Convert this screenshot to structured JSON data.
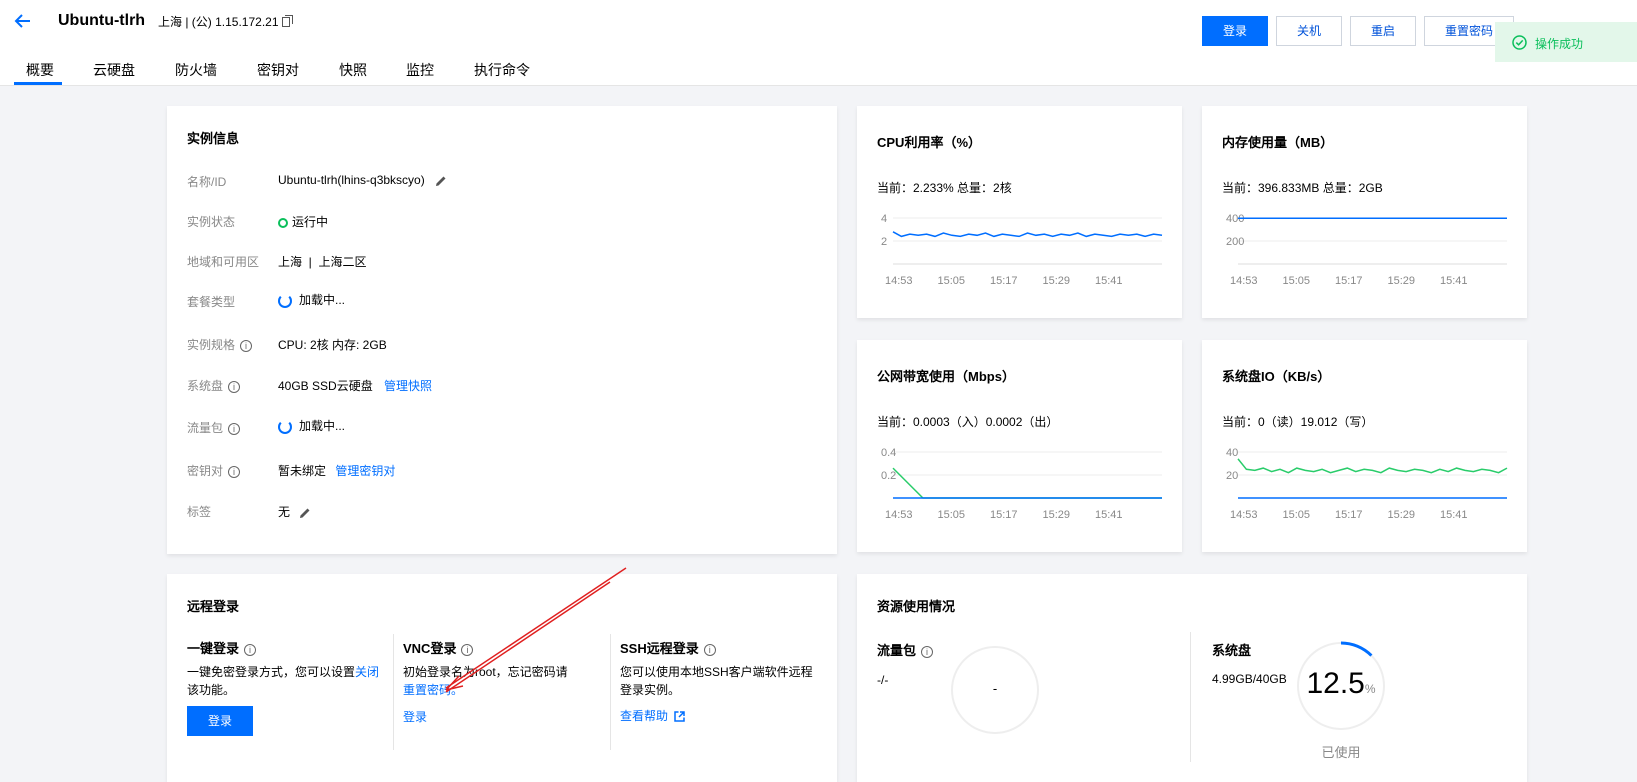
{
  "header": {
    "title": "Ubuntu-tlrh",
    "subtitle": "上海 | (公) 1.15.172.21",
    "buttons": {
      "login": "登录",
      "shutdown": "关机",
      "restart": "重启",
      "reset_password": "重置密码"
    }
  },
  "tabs": [
    "概要",
    "云硬盘",
    "防火墙",
    "密钥对",
    "快照",
    "监控",
    "执行命令"
  ],
  "toast": {
    "text": "操作成功"
  },
  "instance_info": {
    "title": "实例信息",
    "rows": {
      "name_label": "名称/ID",
      "name_value": "Ubuntu-tlrh(lhins-q3bkscyo)",
      "status_label": "实例状态",
      "status_value": "运行中",
      "region_label": "地域和可用区",
      "region_value": "上海  |  上海二区",
      "plan_label": "套餐类型",
      "plan_value": "加载中...",
      "spec_label": "实例规格",
      "spec_value": "CPU: 2核 内存: 2GB",
      "disk_label": "系统盘",
      "disk_value": "40GB SSD云硬盘",
      "disk_link": "管理快照",
      "traffic_label": "流量包",
      "traffic_value": "加载中...",
      "keypair_label": "密钥对",
      "keypair_value": "暂未绑定",
      "keypair_link": "管理密钥对",
      "tag_label": "标签",
      "tag_value": "无"
    }
  },
  "charts": {
    "cpu": {
      "title": "CPU利用率（%）",
      "current": "当前：2.233% 总量：2核"
    },
    "mem": {
      "title": "内存使用量（MB）",
      "current": "当前：396.833MB 总量：2GB"
    },
    "net": {
      "title": "公网带宽使用（Mbps）",
      "current": "当前：0.0003（入）0.0002（出）"
    },
    "disk": {
      "title": "系统盘IO（KB/s）",
      "current": "当前：0（读）19.012（写）"
    }
  },
  "chart_data": [
    {
      "type": "line",
      "title": "CPU利用率（%）",
      "x": [
        "14:53",
        "15:05",
        "15:17",
        "15:29",
        "15:41"
      ],
      "ylim": [
        0,
        4
      ],
      "yticks": [
        2,
        4
      ],
      "series": [
        {
          "values": [
            2.8,
            2.4,
            2.6,
            2.5,
            2.6,
            2.4,
            2.7,
            2.5,
            2.4,
            2.6,
            2.5,
            2.7,
            2.4,
            2.6,
            2.5,
            2.4,
            2.7,
            2.5,
            2.6,
            2.4,
            2.6,
            2.5,
            2.7,
            2.4,
            2.6,
            2.5,
            2.4,
            2.6,
            2.5,
            2.6,
            2.4,
            2.6,
            2.5
          ],
          "color": "#006eff"
        }
      ]
    },
    {
      "type": "line",
      "title": "内存使用量（MB）",
      "x": [
        "14:53",
        "15:05",
        "15:17",
        "15:29",
        "15:41"
      ],
      "ylim": [
        0,
        400
      ],
      "yticks": [
        200,
        400
      ],
      "series": [
        {
          "values": [
            397,
            397,
            397,
            397,
            397,
            397,
            397,
            397,
            397,
            397
          ],
          "color": "#006eff"
        }
      ]
    },
    {
      "type": "line",
      "title": "公网带宽使用（Mbps）",
      "x": [
        "14:53",
        "15:05",
        "15:17",
        "15:29",
        "15:41"
      ],
      "ylim": [
        0,
        0.4
      ],
      "yticks": [
        0.2,
        0.4
      ],
      "series": [
        {
          "values": [
            0.26,
            0.0,
            0.0,
            0.0,
            0.0,
            0.0,
            0.0,
            0.0,
            0.0,
            0.0
          ],
          "color": "#29cc6a"
        },
        {
          "values": [
            0.0,
            0.0,
            0.0,
            0.0,
            0.0,
            0.0,
            0.0,
            0.0,
            0.0,
            0.0
          ],
          "color": "#006eff"
        }
      ]
    },
    {
      "type": "line",
      "title": "系统盘IO（KB/s）",
      "x": [
        "14:53",
        "15:05",
        "15:17",
        "15:29",
        "15:41"
      ],
      "ylim": [
        0,
        40
      ],
      "yticks": [
        20,
        40
      ],
      "series": [
        {
          "values": [
            34,
            25,
            24,
            26,
            23,
            25,
            22,
            26,
            24,
            23,
            25,
            22,
            24,
            26,
            23,
            25,
            24,
            22,
            26,
            24,
            23,
            25,
            24,
            22,
            25,
            23,
            26,
            24,
            23,
            25,
            24,
            22,
            26
          ],
          "color": "#29cc6a"
        },
        {
          "values": [
            0,
            0,
            0,
            0,
            0,
            0,
            0,
            0,
            0,
            0
          ],
          "color": "#006eff"
        }
      ]
    }
  ],
  "remote_login": {
    "title": "远程登录",
    "one_click": {
      "title": "一键登录",
      "desc1": "一键免密登录方式，您可以设置",
      "desc_link": "关闭",
      "desc2": "该功能。",
      "button": "登录"
    },
    "vnc": {
      "title": "VNC登录",
      "desc1": "初始登录名为root，忘记密码请",
      "link_reset": "重置密码。",
      "link_login": "登录"
    },
    "ssh": {
      "title": "SSH远程登录",
      "desc1": "您可以使用本地SSH客户端软件远程",
      "desc2": "登录实例。",
      "link_help": "查看帮助"
    }
  },
  "resource_usage": {
    "title": "资源使用情况",
    "traffic": {
      "label": "流量包",
      "value": "-/-",
      "center": "-"
    },
    "disk": {
      "label": "系统盘",
      "value": "4.99GB/40GB",
      "percent": 12.5,
      "percent_text": "12.5",
      "percent_unit": "%",
      "used_label": "已使用"
    }
  }
}
